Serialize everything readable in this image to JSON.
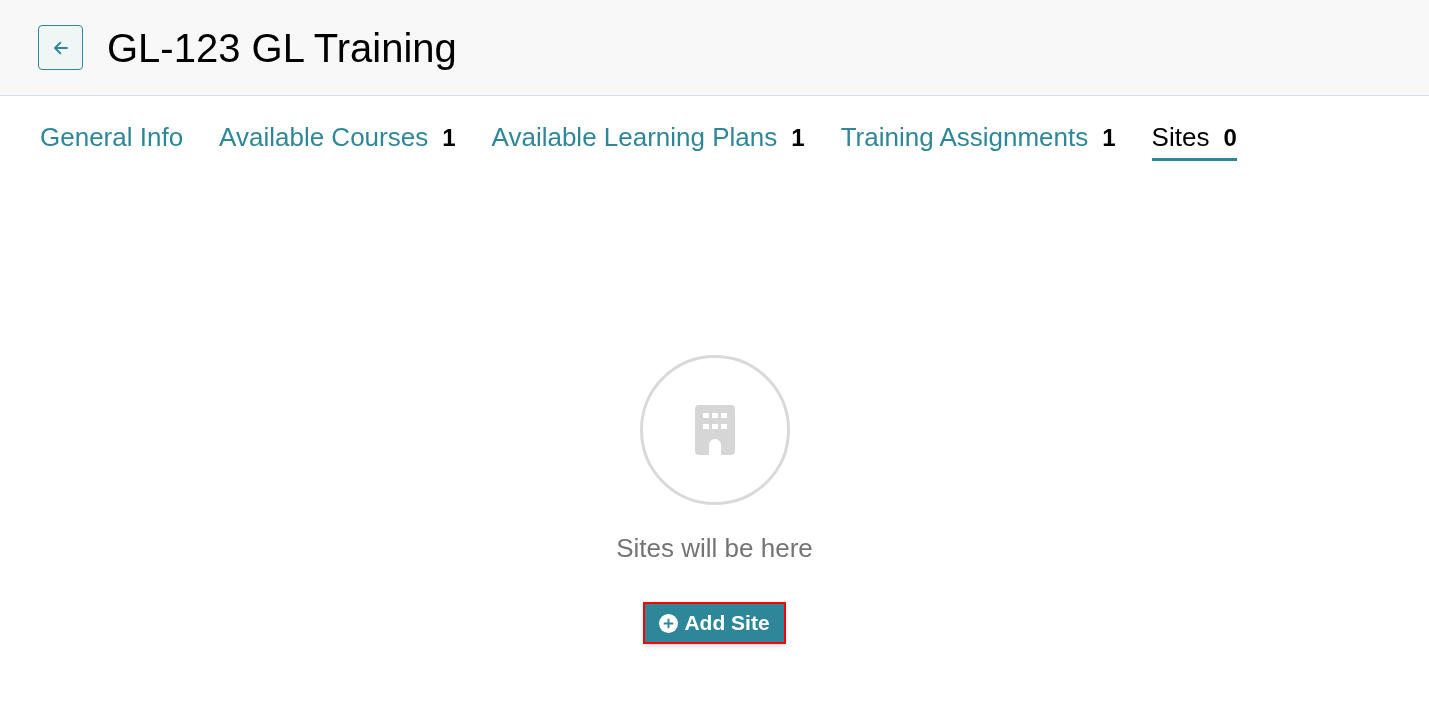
{
  "header": {
    "title": "GL-123 GL Training"
  },
  "tabs": [
    {
      "label": "General Info",
      "selected": false
    },
    {
      "label": "Available Courses",
      "count": "1",
      "selected": false
    },
    {
      "label": "Available Learning Plans",
      "count": "1",
      "selected": false
    },
    {
      "label": "Training Assignments",
      "count": "1",
      "selected": false
    },
    {
      "label": "Sites",
      "count": "0",
      "selected": true
    }
  ],
  "empty_state": {
    "message": "Sites will be here",
    "button": {
      "label": "Add Site",
      "highlighted": true
    }
  }
}
